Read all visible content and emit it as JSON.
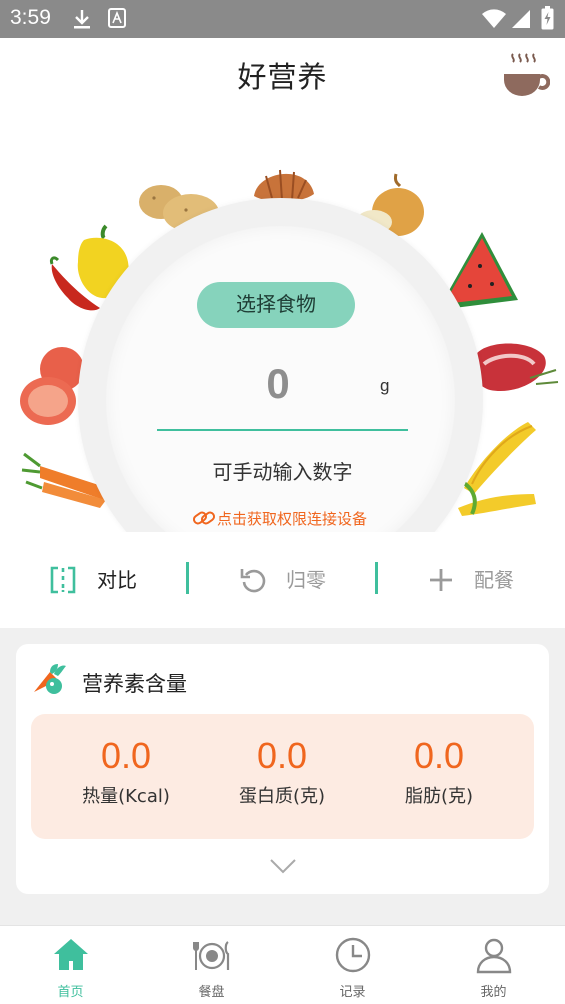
{
  "status_bar": {
    "time": "3:59"
  },
  "header": {
    "title": "好营养",
    "cup_icon": "coffee-cup-icon"
  },
  "scale": {
    "select_food_label": "选择食物",
    "weight_value": "0",
    "weight_unit": "g",
    "manual_hint": "可手动输入数字",
    "connect_link": "点击获取权限连接设备"
  },
  "actions": [
    {
      "label": "对比",
      "icon": "compare-icon"
    },
    {
      "label": "归零",
      "icon": "reset-icon"
    },
    {
      "label": "配餐",
      "icon": "plus-icon"
    }
  ],
  "nutrients": {
    "title": "营养素含量",
    "items": [
      {
        "value": "0.0",
        "label": "热量(Kcal)"
      },
      {
        "value": "0.0",
        "label": "蛋白质(克)"
      },
      {
        "value": "0.0",
        "label": "脂肪(克)"
      }
    ]
  },
  "bottom_nav": [
    {
      "label": "首页",
      "icon": "home-icon",
      "active": true
    },
    {
      "label": "餐盘",
      "icon": "plate-icon",
      "active": false
    },
    {
      "label": "记录",
      "icon": "clock-icon",
      "active": false
    },
    {
      "label": "我的",
      "icon": "user-icon",
      "active": false
    }
  ],
  "colors": {
    "accent": "#3fbf9d",
    "button": "#86d3bc",
    "orange": "#f0661e",
    "panel": "#fdebe2"
  }
}
